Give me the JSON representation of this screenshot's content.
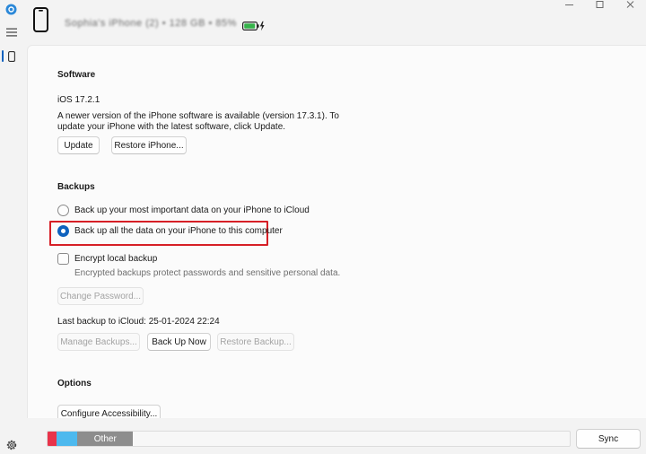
{
  "header": {
    "device_name": "Sophia's iPhone (2) • 128 GB • 85%"
  },
  "software": {
    "heading": "Software",
    "version": "iOS 17.2.1",
    "notice_line1": "A newer version of the iPhone software is available (version 17.3.1). To",
    "notice_line2": "update your iPhone with the latest software, click Update.",
    "update_label": "Update",
    "restore_label": "Restore iPhone..."
  },
  "backups": {
    "heading": "Backups",
    "option_icloud": "Back up your most important data on your iPhone to iCloud",
    "option_computer": "Back up all the data on your iPhone to this computer",
    "selected_option": "computer",
    "encrypt_label": "Encrypt local backup",
    "encrypt_checked": false,
    "encrypt_desc": "Encrypted backups protect passwords and sensitive personal data.",
    "change_password_label": "Change Password...",
    "last_backup": "Last backup to iCloud: 25-01-2024 22:24",
    "manage_label": "Manage Backups...",
    "backup_now_label": "Back Up Now",
    "restore_backup_label": "Restore Backup..."
  },
  "options": {
    "heading": "Options",
    "accessibility_label": "Configure Accessibility..."
  },
  "storage_bar": {
    "segments": [
      {
        "label": "",
        "color": "#e8334a",
        "fraction": 0.017
      },
      {
        "label": "",
        "color": "#4db9ee",
        "fraction": 0.04
      },
      {
        "label": "Other",
        "color": "#8d8d8d",
        "fraction": 0.107
      }
    ]
  },
  "sync_label": "Sync",
  "colors": {
    "accent": "#0f62be",
    "highlight": "#d61f26",
    "battery": "#35b34a"
  },
  "icons": {
    "rail": [
      "app-icon",
      "hamburger-menu-icon",
      "phone-icon",
      "gear-icon"
    ],
    "window": [
      "minimize-icon",
      "maximize-icon",
      "close-icon"
    ]
  }
}
